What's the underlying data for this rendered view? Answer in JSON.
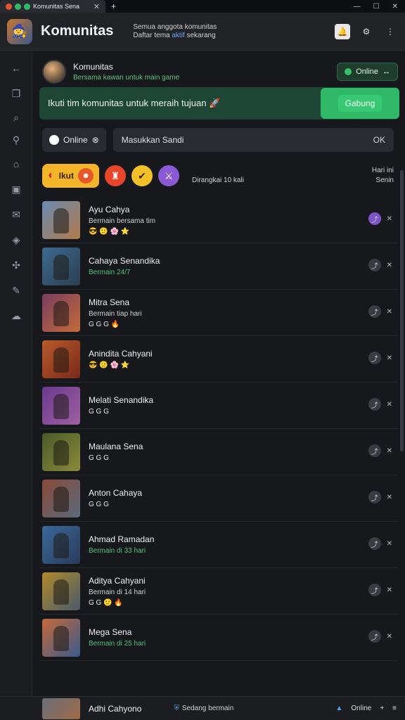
{
  "tab": {
    "title": "Komunitas Sena"
  },
  "header": {
    "title": "Komunitas",
    "sub_line1": "Semua anggota komunitas",
    "sub_line2_a": "Daftar tema ",
    "sub_line2_hl": "aktif",
    "sub_line2_b": " sekarang"
  },
  "profile": {
    "name": "Komunitas",
    "subtitle": "Bersama kawan untuk main game",
    "status_label": "Online"
  },
  "banner": {
    "text": "Ikuti tim komunitas untuk meraih tujuan 🚀",
    "button": "Gabung"
  },
  "filters": {
    "chip_label": "Online",
    "search_value": "Masukkan Sandi",
    "search_end": "OK"
  },
  "badges": {
    "main_label": "Ikut",
    "caption": "Dirangkai 10 kali",
    "right_top": "Hari ini",
    "right_bottom": "Senin"
  },
  "rows": [
    {
      "title": "Ayu Cahya",
      "sub": "Bermain bersama tim",
      "sub_green": false,
      "thumb": [
        "#6b8bb1",
        "#b07a4a"
      ],
      "emoji": "😎 🙂 🌸 ⭐"
    },
    {
      "title": "Cahaya Senandika",
      "sub": "Bermain 24/7",
      "sub_green": true,
      "thumb": [
        "#3d6a8f",
        "#2c3e50"
      ],
      "emoji": ""
    },
    {
      "title": "Mitra Sena",
      "sub": "Bermain tiap hari",
      "sub_green": false,
      "thumb": [
        "#7a3d5f",
        "#c46a3a"
      ],
      "emoji": "G G G 🔥"
    },
    {
      "title": "Anindita Cahyani",
      "sub": "",
      "sub_green": false,
      "thumb": [
        "#b85a2a",
        "#7a2a1a"
      ],
      "emoji": "😎 🙂 🌸 ⭐"
    },
    {
      "title": "Melati Senandika",
      "sub": "",
      "sub_green": false,
      "thumb": [
        "#6a3a8f",
        "#a05fa0"
      ],
      "emoji": "G G G"
    },
    {
      "title": "Maulana Sena",
      "sub": "",
      "sub_green": false,
      "thumb": [
        "#4a5a2a",
        "#8a8a3a"
      ],
      "emoji": "G G G"
    },
    {
      "title": "Anton Cahaya",
      "sub": "",
      "sub_green": false,
      "thumb": [
        "#8a4a3a",
        "#5a6a7a"
      ],
      "emoji": "G G G"
    },
    {
      "title": "Ahmad Ramadan",
      "sub": "Bermain di 33 hari",
      "sub_green": true,
      "thumb": [
        "#3a6a9a",
        "#2a3a5a"
      ],
      "emoji": ""
    },
    {
      "title": "Aditya Cahyani",
      "sub": "Bermain di 14 hari",
      "sub_green": false,
      "thumb": [
        "#b08a2a",
        "#4a5a6a"
      ],
      "emoji": "G G 🙂 🔥"
    },
    {
      "title": "Mega Sena",
      "sub": "Bermain di 25 hari",
      "sub_green": true,
      "thumb": [
        "#c46a3a",
        "#3a5a8a"
      ],
      "emoji": ""
    }
  ],
  "footer": {
    "title": "Adhi Cahyono",
    "mid": "Sedang bermain",
    "right": "Online"
  }
}
